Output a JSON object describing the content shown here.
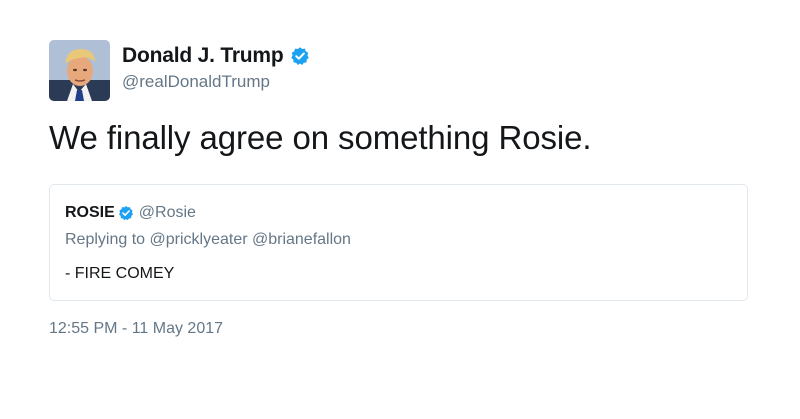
{
  "tweet": {
    "display_name": "Donald J. Trump",
    "handle": "@realDonaldTrump",
    "verified": true,
    "text": "We finally agree on something Rosie.",
    "timestamp": "12:55 PM - 11 May 2017",
    "avatar_icon": "profile-photo"
  },
  "quoted_tweet": {
    "display_name": "ROSIE",
    "handle": "@Rosie",
    "verified": true,
    "reply_prefix": "Replying to",
    "reply_to": [
      "@pricklyeater",
      "@brianefallon"
    ],
    "reply_line": "Replying to @pricklyeater @brianefallon",
    "text": "- FIRE COMEY"
  },
  "colors": {
    "text_primary": "#14171a",
    "text_secondary": "#657786",
    "verified_blue": "#1da1f2",
    "border": "#e1e8ed"
  }
}
